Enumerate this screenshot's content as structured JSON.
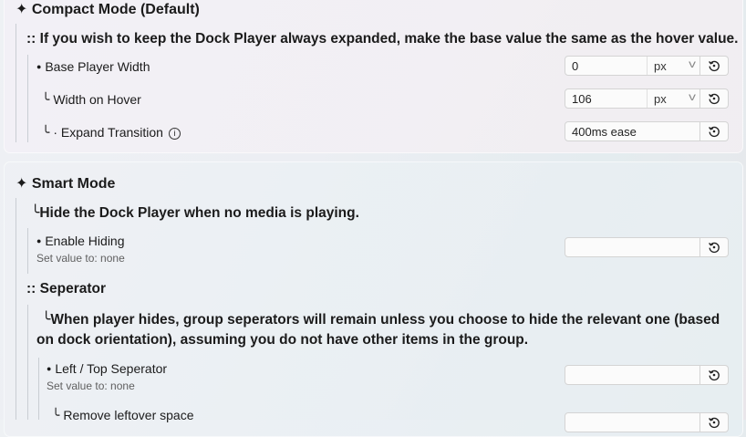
{
  "compact": {
    "title": "✦ Compact Mode (Default)",
    "note_glyph": "::",
    "note": "If you wish to keep the Dock Player always expanded, make the base value the same as the hover value.",
    "rows": [
      {
        "glyph": "●",
        "label": "Base Player Width",
        "value": "0",
        "unit": "px"
      },
      {
        "glyph": "╰",
        "label": "Width on Hover",
        "value": "106",
        "unit": "px"
      },
      {
        "glyph": "╰ ·",
        "label": "Expand Transition",
        "value": "400ms ease",
        "info": "i"
      }
    ]
  },
  "smart": {
    "title": "✦ Smart Mode",
    "hide_glyph": "╰",
    "hide_note": "Hide the Dock Player when no media is playing.",
    "enable": {
      "glyph": "●",
      "label": "Enable Hiding",
      "hint": "Set value to: none",
      "value": ""
    },
    "separator": {
      "glyph": "::",
      "title": "Seperator",
      "note_glyph": "╰",
      "note_line1": "When player hides, group seperators will remain unless you choose to hide the relevant one (based",
      "note_line2": "on dock orientation), assuming you do not have other items in the group.",
      "left_top": {
        "glyph": "●",
        "label": "Left / Top Seperator",
        "hint": "Set value to: none",
        "value": ""
      },
      "remove": {
        "glyph": "╰",
        "label": "Remove leftover space",
        "value": ""
      }
    }
  },
  "icons": {
    "reset": "reset-icon",
    "chevron": "chevron-down-icon",
    "info": "info-icon"
  }
}
